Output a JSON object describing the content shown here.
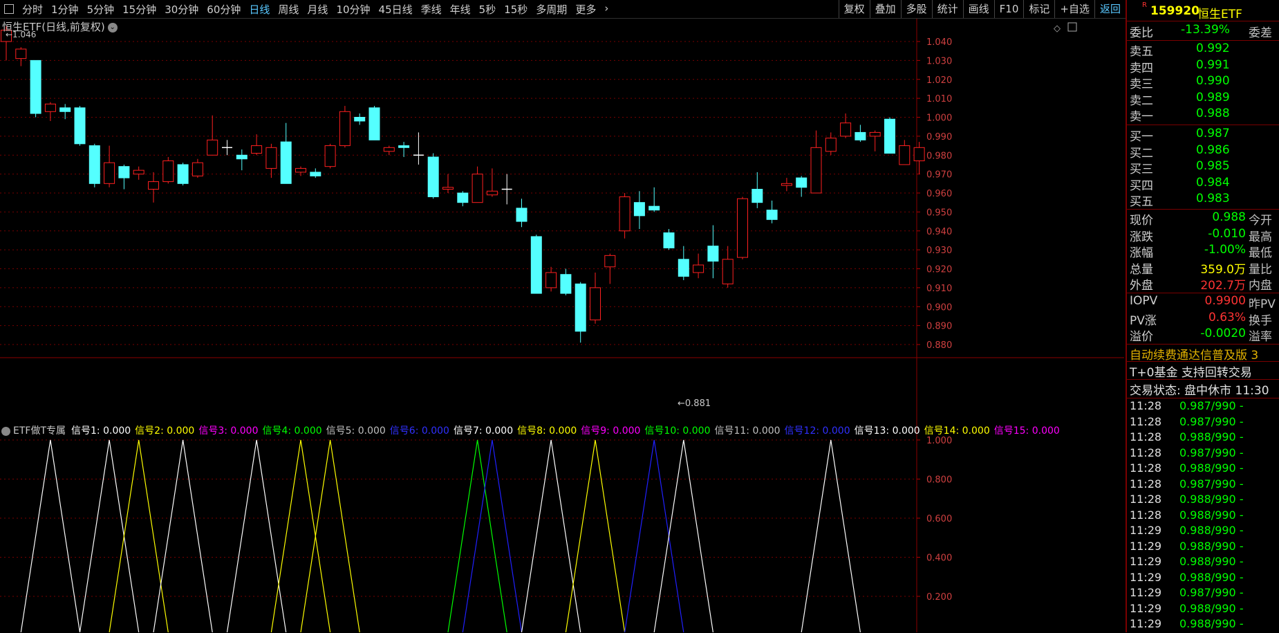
{
  "toolbar": {
    "periods": [
      "分时",
      "1分钟",
      "5分钟",
      "15分钟",
      "30分钟",
      "60分钟",
      "日线",
      "周线",
      "月线",
      "10分钟",
      "45日线",
      "季线",
      "年线",
      "5秒",
      "15秒",
      "多周期",
      "更多"
    ],
    "active_period": "日线",
    "right_buttons": [
      "复权",
      "叠加",
      "多股",
      "统计",
      "画线",
      "F10",
      "标记",
      "+自选",
      "返回"
    ]
  },
  "main_chart": {
    "title": "恒生ETF(日线,前复权)",
    "high_label": "1.046",
    "low_label": "0.881",
    "y_ticks": [
      "1.040",
      "1.030",
      "1.020",
      "1.010",
      "1.000",
      "0.990",
      "0.980",
      "0.970",
      "0.960",
      "0.950",
      "0.940",
      "0.930",
      "0.920",
      "0.910",
      "0.900",
      "0.890",
      "0.880"
    ],
    "candles": [
      {
        "o": 1.04,
        "c": 1.046,
        "h": 1.048,
        "l": 1.03
      },
      {
        "o": 1.031,
        "c": 1.036,
        "h": 1.037,
        "l": 1.027
      },
      {
        "o": 1.03,
        "c": 1.002,
        "h": 1.03,
        "l": 1.0
      },
      {
        "o": 1.003,
        "c": 1.007,
        "h": 1.008,
        "l": 0.998
      },
      {
        "o": 1.005,
        "c": 1.003,
        "h": 1.007,
        "l": 0.999
      },
      {
        "o": 1.005,
        "c": 0.986,
        "h": 1.006,
        "l": 0.985
      },
      {
        "o": 0.985,
        "c": 0.965,
        "h": 0.986,
        "l": 0.963
      },
      {
        "o": 0.965,
        "c": 0.976,
        "h": 0.985,
        "l": 0.963
      },
      {
        "o": 0.974,
        "c": 0.968,
        "h": 0.975,
        "l": 0.962
      },
      {
        "o": 0.97,
        "c": 0.972,
        "h": 0.974,
        "l": 0.967
      },
      {
        "o": 0.962,
        "c": 0.966,
        "h": 0.971,
        "l": 0.955
      },
      {
        "o": 0.966,
        "c": 0.977,
        "h": 0.979,
        "l": 0.965
      },
      {
        "o": 0.975,
        "c": 0.965,
        "h": 0.976,
        "l": 0.964
      },
      {
        "o": 0.969,
        "c": 0.976,
        "h": 0.978,
        "l": 0.968
      },
      {
        "o": 0.98,
        "c": 0.988,
        "h": 1.001,
        "l": 0.98
      },
      {
        "o": 0.984,
        "c": 0.984,
        "h": 0.988,
        "l": 0.98
      },
      {
        "o": 0.98,
        "c": 0.978,
        "h": 0.983,
        "l": 0.972
      },
      {
        "o": 0.981,
        "c": 0.985,
        "h": 0.991,
        "l": 0.98
      },
      {
        "o": 0.973,
        "c": 0.984,
        "h": 0.986,
        "l": 0.968
      },
      {
        "o": 0.987,
        "c": 0.965,
        "h": 0.997,
        "l": 0.965
      },
      {
        "o": 0.971,
        "c": 0.973,
        "h": 0.974,
        "l": 0.969
      },
      {
        "o": 0.971,
        "c": 0.969,
        "h": 0.973,
        "l": 0.968
      },
      {
        "o": 0.974,
        "c": 0.985,
        "h": 0.986,
        "l": 0.973
      },
      {
        "o": 0.985,
        "c": 1.003,
        "h": 1.006,
        "l": 0.984
      },
      {
        "o": 1.0,
        "c": 0.998,
        "h": 1.002,
        "l": 0.996
      },
      {
        "o": 1.005,
        "c": 0.988,
        "h": 1.006,
        "l": 0.988
      },
      {
        "o": 0.982,
        "c": 0.984,
        "h": 0.985,
        "l": 0.98
      },
      {
        "o": 0.985,
        "c": 0.984,
        "h": 0.987,
        "l": 0.979
      },
      {
        "o": 0.98,
        "c": 0.98,
        "h": 0.992,
        "l": 0.975
      },
      {
        "o": 0.979,
        "c": 0.958,
        "h": 0.981,
        "l": 0.957
      },
      {
        "o": 0.962,
        "c": 0.963,
        "h": 0.97,
        "l": 0.96
      },
      {
        "o": 0.96,
        "c": 0.955,
        "h": 0.961,
        "l": 0.953
      },
      {
        "o": 0.955,
        "c": 0.97,
        "h": 0.974,
        "l": 0.955
      },
      {
        "o": 0.959,
        "c": 0.961,
        "h": 0.973,
        "l": 0.958
      },
      {
        "o": 0.962,
        "c": 0.962,
        "h": 0.97,
        "l": 0.954
      },
      {
        "o": 0.952,
        "c": 0.945,
        "h": 0.957,
        "l": 0.942
      },
      {
        "o": 0.937,
        "c": 0.907,
        "h": 0.938,
        "l": 0.907
      },
      {
        "o": 0.91,
        "c": 0.918,
        "h": 0.921,
        "l": 0.908
      },
      {
        "o": 0.917,
        "c": 0.907,
        "h": 0.92,
        "l": 0.906
      },
      {
        "o": 0.912,
        "c": 0.887,
        "h": 0.913,
        "l": 0.881
      },
      {
        "o": 0.893,
        "c": 0.91,
        "h": 0.918,
        "l": 0.891
      },
      {
        "o": 0.921,
        "c": 0.927,
        "h": 0.928,
        "l": 0.912
      },
      {
        "o": 0.94,
        "c": 0.958,
        "h": 0.96,
        "l": 0.936
      },
      {
        "o": 0.955,
        "c": 0.948,
        "h": 0.961,
        "l": 0.941
      },
      {
        "o": 0.953,
        "c": 0.951,
        "h": 0.963,
        "l": 0.95
      },
      {
        "o": 0.939,
        "c": 0.931,
        "h": 0.941,
        "l": 0.93
      },
      {
        "o": 0.925,
        "c": 0.916,
        "h": 0.932,
        "l": 0.914
      },
      {
        "o": 0.918,
        "c": 0.922,
        "h": 0.928,
        "l": 0.915
      },
      {
        "o": 0.932,
        "c": 0.924,
        "h": 0.943,
        "l": 0.915
      },
      {
        "o": 0.912,
        "c": 0.925,
        "h": 0.932,
        "l": 0.91
      },
      {
        "o": 0.926,
        "c": 0.957,
        "h": 0.958,
        "l": 0.925
      },
      {
        "o": 0.962,
        "c": 0.955,
        "h": 0.971,
        "l": 0.952
      },
      {
        "o": 0.951,
        "c": 0.946,
        "h": 0.956,
        "l": 0.944
      },
      {
        "o": 0.964,
        "c": 0.965,
        "h": 0.968,
        "l": 0.961
      },
      {
        "o": 0.968,
        "c": 0.963,
        "h": 0.969,
        "l": 0.958
      },
      {
        "o": 0.96,
        "c": 0.984,
        "h": 0.993,
        "l": 0.96
      },
      {
        "o": 0.982,
        "c": 0.989,
        "h": 0.992,
        "l": 0.98
      },
      {
        "o": 0.99,
        "c": 0.997,
        "h": 1.002,
        "l": 0.989
      },
      {
        "o": 0.992,
        "c": 0.988,
        "h": 0.996,
        "l": 0.987
      },
      {
        "o": 0.99,
        "c": 0.992,
        "h": 0.993,
        "l": 0.982
      },
      {
        "o": 0.999,
        "c": 0.981,
        "h": 1.0,
        "l": 0.981
      },
      {
        "o": 0.975,
        "c": 0.985,
        "h": 0.988,
        "l": 0.975
      },
      {
        "o": 0.977,
        "c": 0.984,
        "h": 0.987,
        "l": 0.97
      }
    ]
  },
  "indicator": {
    "title": "ETF做T专属",
    "signals": [
      {
        "label": "信号1: 0.000",
        "color": "#ffffff"
      },
      {
        "label": "信号2: 0.000",
        "color": "#ffff00"
      },
      {
        "label": "信号3: 0.000",
        "color": "#ff00ff"
      },
      {
        "label": "信号4: 0.000",
        "color": "#00ff00"
      },
      {
        "label": "信号5: 0.000",
        "color": "#c0c0c0"
      },
      {
        "label": "信号6: 0.000",
        "color": "#3030ff"
      },
      {
        "label": "信号7: 0.000",
        "color": "#ffffff"
      },
      {
        "label": "信号8: 0.000",
        "color": "#ffff00"
      },
      {
        "label": "信号9: 0.000",
        "color": "#ff00ff"
      },
      {
        "label": "信号10: 0.000",
        "color": "#00ff00"
      },
      {
        "label": "信号11: 0.000",
        "color": "#c0c0c0"
      },
      {
        "label": "信号12: 0.000",
        "color": "#3030ff"
      },
      {
        "label": "信号13: 0.000",
        "color": "#ffffff"
      },
      {
        "label": "信号14: 0.000",
        "color": "#ffff00"
      },
      {
        "label": "信号15: 0.000",
        "color": "#ff00ff"
      }
    ],
    "y_ticks": [
      "1.000",
      "0.800",
      "0.600",
      "0.400",
      "0.200"
    ],
    "spikes": [
      {
        "bar": 3,
        "color": "#ffffff"
      },
      {
        "bar": 7,
        "color": "#ffffff"
      },
      {
        "bar": 9,
        "color": "#ffff00"
      },
      {
        "bar": 12,
        "color": "#ffffff"
      },
      {
        "bar": 17,
        "color": "#ffffff"
      },
      {
        "bar": 20,
        "color": "#ffff00"
      },
      {
        "bar": 22,
        "color": "#ffff00"
      },
      {
        "bar": 32,
        "color": "#00ff00"
      },
      {
        "bar": 33,
        "color": "#2020ff"
      },
      {
        "bar": 37,
        "color": "#ffffff"
      },
      {
        "bar": 40,
        "color": "#ffff00"
      },
      {
        "bar": 44,
        "color": "#2020ff"
      },
      {
        "bar": 46,
        "color": "#ffffff"
      },
      {
        "bar": 56,
        "color": "#ffffff"
      }
    ]
  },
  "quote_panel": {
    "code": "159920",
    "name": "恒生ETF",
    "badge": "R",
    "weibi_label": "委比",
    "weibi_value": "-13.39%",
    "weicha_label": "委差",
    "sells": [
      {
        "label": "卖五",
        "price": "0.992"
      },
      {
        "label": "卖四",
        "price": "0.991"
      },
      {
        "label": "卖三",
        "price": "0.990"
      },
      {
        "label": "卖二",
        "price": "0.989"
      },
      {
        "label": "卖一",
        "price": "0.988"
      }
    ],
    "buys": [
      {
        "label": "买一",
        "price": "0.987"
      },
      {
        "label": "买二",
        "price": "0.986"
      },
      {
        "label": "买三",
        "price": "0.985"
      },
      {
        "label": "买四",
        "price": "0.984"
      },
      {
        "label": "买五",
        "price": "0.983"
      }
    ],
    "stats": [
      {
        "l1": "现价",
        "v": "0.988",
        "vc": "#00ff00",
        "l2": "今开"
      },
      {
        "l1": "涨跌",
        "v": "-0.010",
        "vc": "#00ff00",
        "l2": "最高"
      },
      {
        "l1": "涨幅",
        "v": "-1.00%",
        "vc": "#00ff00",
        "l2": "最低"
      },
      {
        "l1": "总量",
        "v": "359.0万",
        "vc": "#ffff00",
        "l2": "量比"
      },
      {
        "l1": "外盘",
        "v": "202.7万",
        "vc": "#ff3333",
        "l2": "内盘"
      }
    ],
    "stats2": [
      {
        "l1": "IOPV",
        "v": "0.9900",
        "vc": "#ff3333",
        "l2": "昨PV"
      },
      {
        "l1": "PV涨",
        "v": "0.63%",
        "vc": "#ff3333",
        "l2": "换手"
      },
      {
        "l1": "溢价",
        "v": "-0.0020",
        "vc": "#00ff00",
        "l2": "溢率"
      }
    ],
    "ad_text": "自动续费通达信普及版 3",
    "info1": "T+0基金 支持回转交易",
    "trade_status": "交易状态: 盘中休市 11:30",
    "trades": [
      {
        "t": "11:28",
        "p": "0.987/990 -"
      },
      {
        "t": "11:28",
        "p": "0.987/990 -"
      },
      {
        "t": "11:28",
        "p": "0.988/990 -"
      },
      {
        "t": "11:28",
        "p": "0.987/990 -"
      },
      {
        "t": "11:28",
        "p": "0.988/990 -"
      },
      {
        "t": "11:28",
        "p": "0.987/990 -"
      },
      {
        "t": "11:28",
        "p": "0.988/990 -"
      },
      {
        "t": "11:28",
        "p": "0.988/990 -"
      },
      {
        "t": "11:29",
        "p": "0.988/990 -"
      },
      {
        "t": "11:29",
        "p": "0.988/990 -"
      },
      {
        "t": "11:29",
        "p": "0.988/990 -"
      },
      {
        "t": "11:29",
        "p": "0.988/990 -"
      },
      {
        "t": "11:29",
        "p": "0.987/990 -"
      },
      {
        "t": "11:29",
        "p": "0.988/990 -"
      },
      {
        "t": "11:29",
        "p": "0.988/990 -"
      }
    ]
  }
}
